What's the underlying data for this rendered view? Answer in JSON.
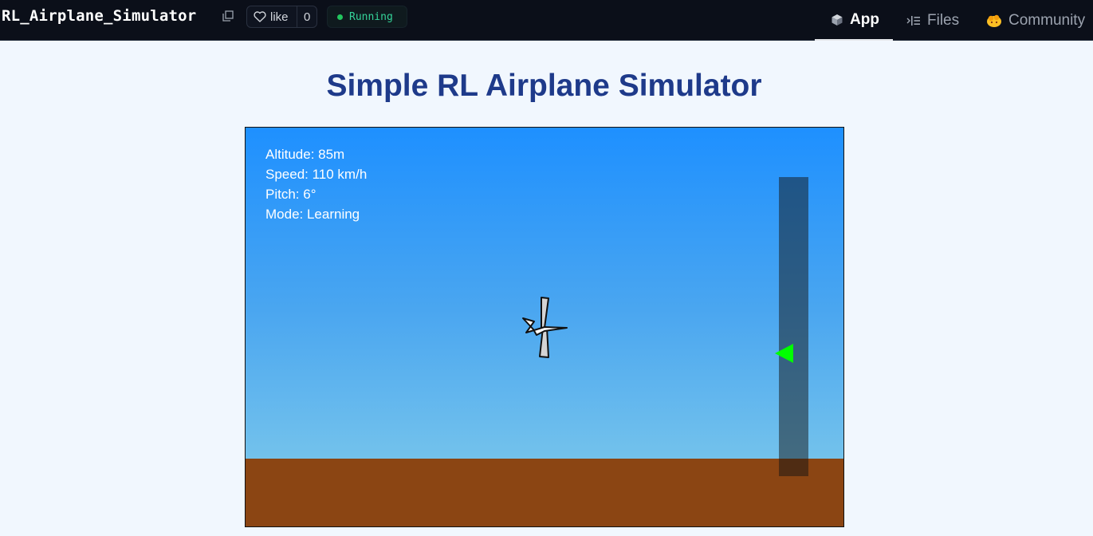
{
  "header": {
    "repo_name": "RL_Airplane_Simulator",
    "like_label": "like",
    "like_count": "0",
    "status": "Running",
    "tabs": [
      {
        "label": "App",
        "icon": "cube-icon",
        "active": true
      },
      {
        "label": "Files",
        "icon": "files-icon",
        "active": false
      },
      {
        "label": "Community",
        "icon": "community-icon",
        "active": false
      }
    ]
  },
  "main": {
    "title": "Simple RL Airplane Simulator"
  },
  "simulator": {
    "hud": {
      "altitude": "Altitude: 85m",
      "speed": "Speed: 110 km/h",
      "pitch": "Pitch: 6°",
      "mode": "Mode: Learning"
    },
    "altitude_indicator_level": 0.41,
    "colors": {
      "sky_top": "#1e90ff",
      "sky_bottom": "#73c2ec",
      "ground": "#8b4513",
      "marker": "#00ff00",
      "title": "#1e3a8a"
    }
  }
}
